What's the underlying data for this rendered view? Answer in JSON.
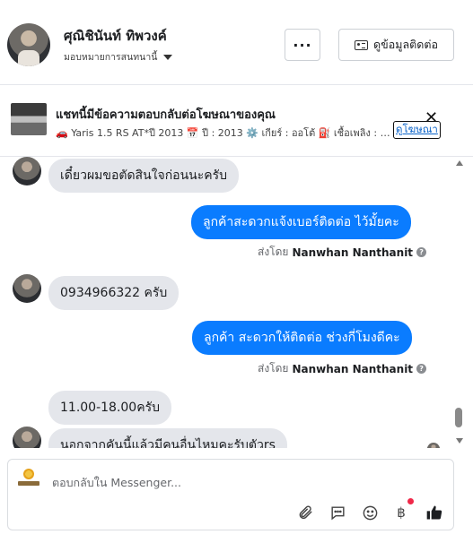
{
  "header": {
    "contact_name": "ศุณิชินันท์ ทิพวงค์",
    "assign_label": "มอบหมายการสนทนานี้",
    "more_label": "···",
    "contact_button_label": "ดูข้อมูลติดต่อ"
  },
  "ad": {
    "title": "แชทนี้มีข้อความตอบกลับต่อโฆษณาของคุณ",
    "subtitle": "🚗 Yaris 1.5 RS AT*ปี 2013 📅 ปี : 2013 ⚙️ เกียร์ : ออโต้ ⛽ เชื้อเพลิง : เบนซิน",
    "view_ad_label": "ดูโฆษณา",
    "close_label": "✕"
  },
  "messages": [
    {
      "dir": "in",
      "text": "เดี๋ยวผมขอตัดสินใจก่อนนะครับ"
    },
    {
      "dir": "out",
      "text": "ลูกค้าสะดวกแจ้งเบอร์ติดต่อ ไว้มั้ยคะ"
    },
    {
      "dir": "in",
      "text": "0934966322 ครับ"
    },
    {
      "dir": "out",
      "text": "ลูกค้า สะดวกให้ติดต่อ ช่วงกี่โมงดีคะ"
    },
    {
      "dir": "in",
      "text": "11.00-18.00ครับ"
    },
    {
      "dir": "in",
      "text": "นอกจากคันนี้แล้วมีคนอื่นไหมคะรับตัวrs"
    }
  ],
  "sent_by": {
    "prefix": "ส่งโดย",
    "name": "Nanwhan Nanthanit",
    "help": "?"
  },
  "composer": {
    "placeholder": "ตอบกลับใน Messenger..."
  },
  "colors": {
    "outgoing_bubble": "#0a7cff",
    "incoming_bubble": "#e4e6eb",
    "link": "#0b63c9",
    "notification_dot": "#f02849",
    "like_icon": "#1c1e21"
  },
  "icons": {
    "attach": "paperclip-icon",
    "saved_replies": "speech-bubble-icon",
    "emoji": "smiley-icon",
    "payment": "baht-icon",
    "like": "thumbs-up-icon"
  }
}
